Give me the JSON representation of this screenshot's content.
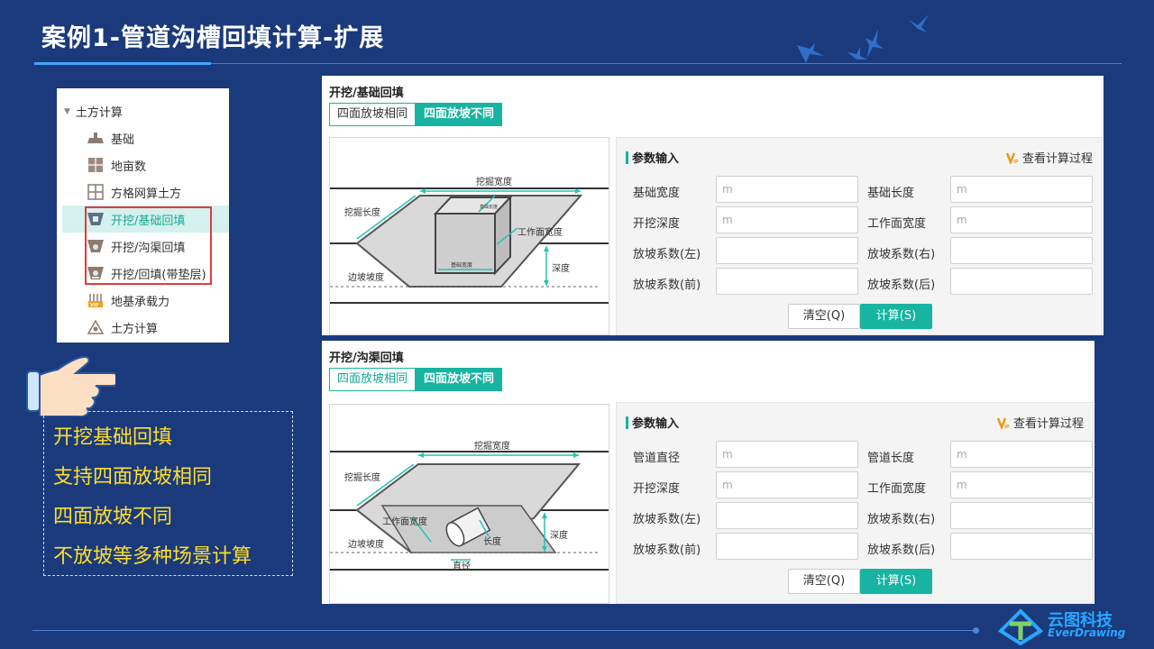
{
  "slide": {
    "title": "案例1-管道沟槽回填计算-扩展",
    "logo_cn": "云图科技",
    "logo_en": "EverDrawing"
  },
  "tree": {
    "root_label": "土方计算",
    "items": [
      {
        "label": "基础",
        "icon": "foundation-icon"
      },
      {
        "label": "地亩数",
        "icon": "land-area-icon"
      },
      {
        "label": "方格网算土方",
        "icon": "grid-icon"
      },
      {
        "label": "开挖/基础回填",
        "icon": "excavation-icon",
        "selected": true
      },
      {
        "label": "开挖/沟渠回填",
        "icon": "trench-icon"
      },
      {
        "label": "开挖/回填(带垫层)",
        "icon": "cushion-icon"
      },
      {
        "label": "地基承载力",
        "icon": "bearing-vip-icon"
      },
      {
        "label": "土方计算",
        "icon": "earthwork-icon"
      }
    ]
  },
  "callout": {
    "lines": [
      "开挖基础回填",
      "支持四面放坡相同",
      "四面放坡不同",
      "不放坡等多种场景计算"
    ]
  },
  "panel1": {
    "title": "开挖/基础回填",
    "tab_same": "四面放坡相同",
    "tab_diff": "四面放坡不同",
    "diagram": {
      "top_width": "挖掘宽度",
      "length": "挖掘长度",
      "work_width": "工作面宽度",
      "slope": "边坡坡度",
      "depth": "深度",
      "base_width": "基础宽度",
      "base_length": "基础长度"
    },
    "form_title": "参数输入",
    "view_process": "查看计算过程",
    "fields": [
      {
        "label": "基础宽度",
        "placeholder": "m"
      },
      {
        "label": "基础长度",
        "placeholder": "m"
      },
      {
        "label": "开挖深度",
        "placeholder": "m"
      },
      {
        "label": "工作面宽度",
        "placeholder": "m"
      },
      {
        "label": "放坡系数(左)",
        "placeholder": ""
      },
      {
        "label": "放坡系数(右)",
        "placeholder": ""
      },
      {
        "label": "放坡系数(前)",
        "placeholder": ""
      },
      {
        "label": "放坡系数(后)",
        "placeholder": ""
      }
    ],
    "btn_clear": "清空(Q)",
    "btn_calc": "计算(S)"
  },
  "panel2": {
    "title": "开挖/沟渠回填",
    "tab_same": "四面放坡相同",
    "tab_diff": "四面放坡不同",
    "diagram": {
      "top_width": "挖掘宽度",
      "length_label": "挖掘长度",
      "work_width": "工作面宽度",
      "slope": "边坡坡度",
      "depth": "深度",
      "pipe_length": "长度",
      "diameter": "直径"
    },
    "form_title": "参数输入",
    "view_process": "查看计算过程",
    "fields": [
      {
        "label": "管道直径",
        "placeholder": "m"
      },
      {
        "label": "管道长度",
        "placeholder": "m"
      },
      {
        "label": "开挖深度",
        "placeholder": "m"
      },
      {
        "label": "工作面宽度",
        "placeholder": "m"
      },
      {
        "label": "放坡系数(左)",
        "placeholder": ""
      },
      {
        "label": "放坡系数(右)",
        "placeholder": ""
      },
      {
        "label": "放坡系数(前)",
        "placeholder": ""
      },
      {
        "label": "放坡系数(后)",
        "placeholder": ""
      }
    ],
    "btn_clear": "清空(Q)",
    "btn_calc": "计算(S)"
  },
  "colors": {
    "background": "#1b3a7c",
    "accent": "#17b4a1",
    "highlight": "#ffde2b",
    "marker": "#e03b3b"
  }
}
